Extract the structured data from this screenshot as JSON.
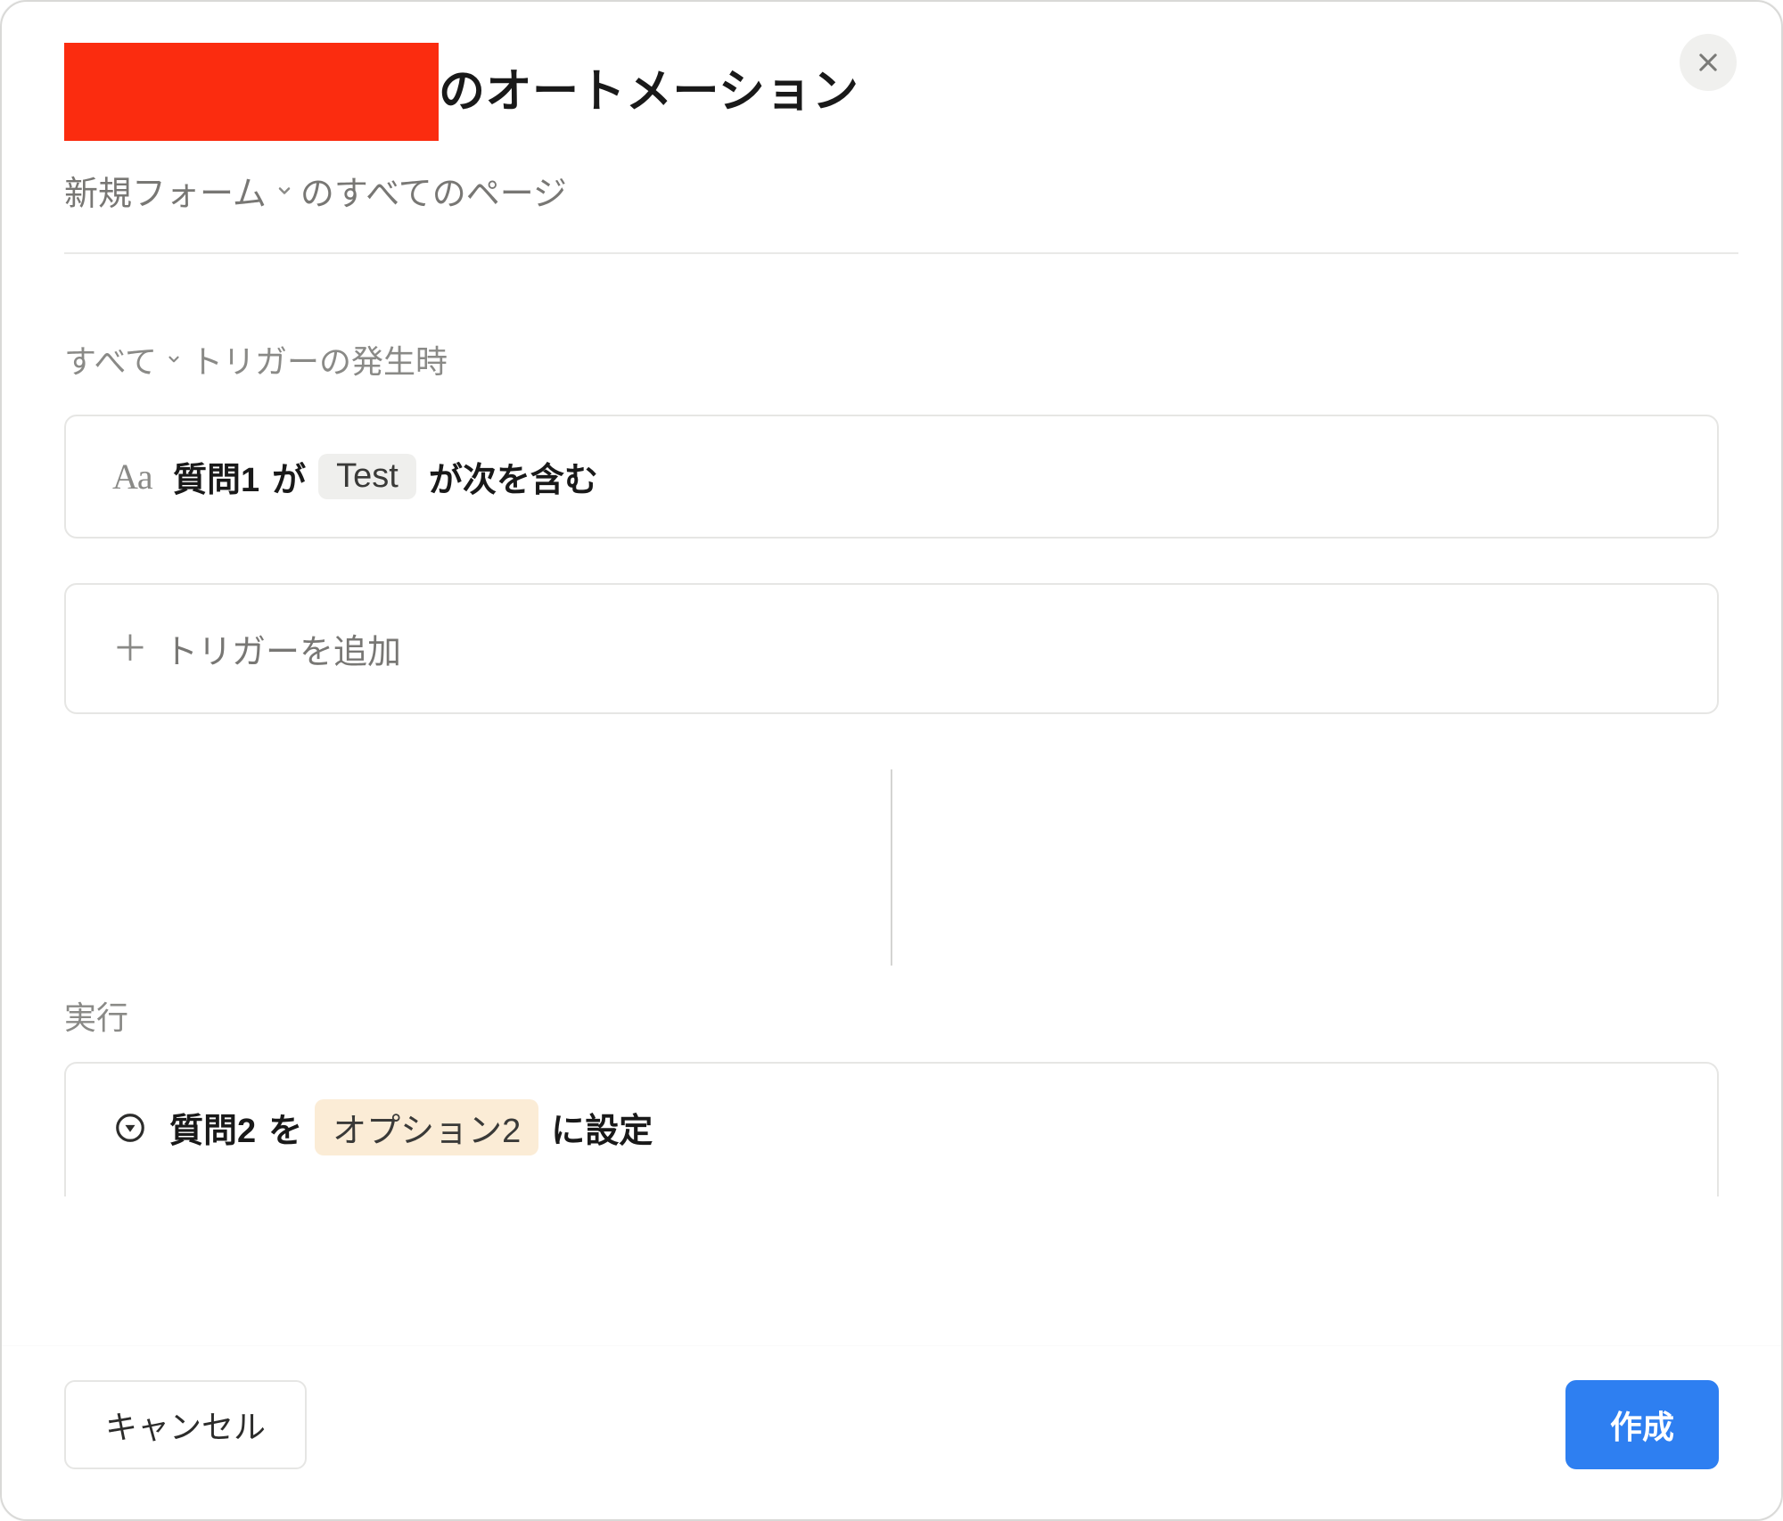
{
  "header": {
    "title_suffix": "のオートメーション",
    "form_selector_label": "新規フォーム",
    "form_selector_suffix": "のすべてのページ"
  },
  "triggers_section": {
    "scope_label": "すべて",
    "heading_suffix": "トリガーの発生時",
    "condition": {
      "field_label": "質問1",
      "particle_1": "が",
      "value_chip": "Test",
      "operator": "が次を含む"
    },
    "add_trigger_label": "トリガーを追加"
  },
  "actions_section": {
    "heading": "実行",
    "action": {
      "field_label": "質問2",
      "particle_1": "を",
      "value_chip": "オプション2",
      "operator": "に設定"
    }
  },
  "footer": {
    "cancel_label": "キャンセル",
    "create_label": "作成"
  }
}
